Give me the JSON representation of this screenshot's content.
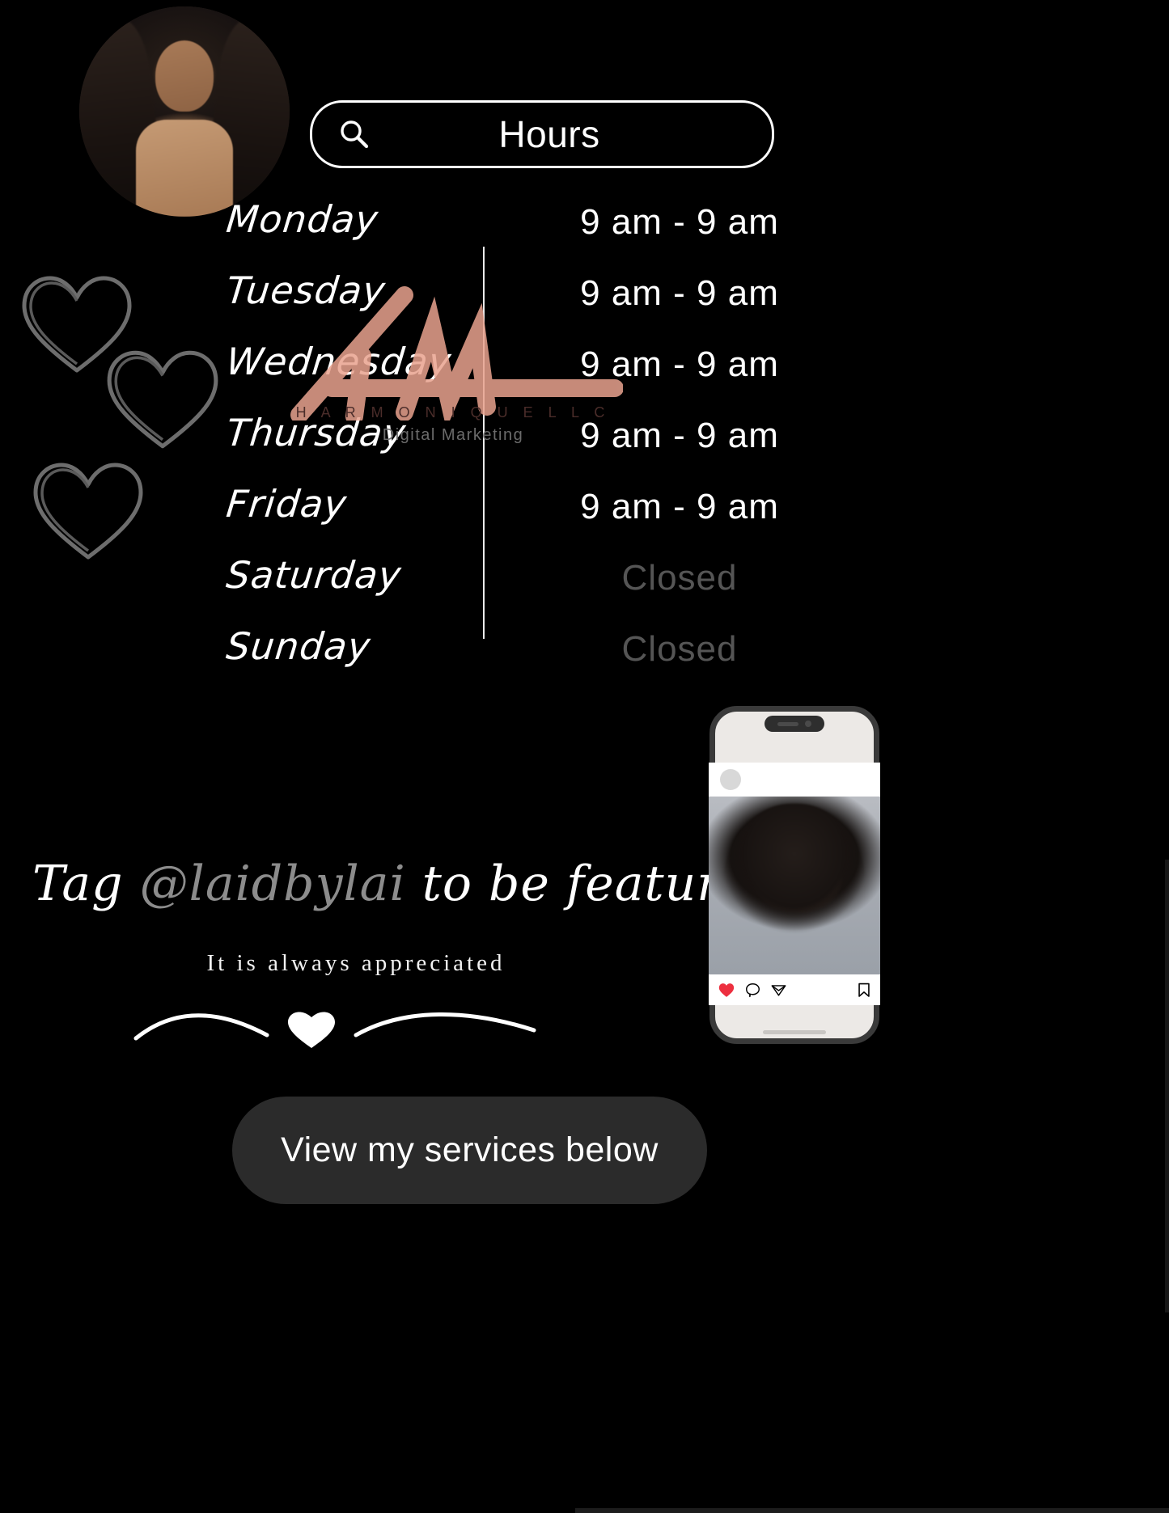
{
  "page": {
    "background_color": "#000000",
    "text_color": "#ffffff"
  },
  "profile": {
    "avatar_alt": "profile-photo-curly-hair"
  },
  "search": {
    "icon": "search-icon",
    "query": "Hours"
  },
  "hours": {
    "divider": true,
    "closed_label": "Closed",
    "closed_color": "#555555",
    "rows": [
      {
        "day": "Monday",
        "time": "9 am - 9 am",
        "closed": false
      },
      {
        "day": "Tuesday",
        "time": "9 am - 9 am",
        "closed": false
      },
      {
        "day": "Wednesday",
        "time": "9 am - 9 am",
        "closed": false
      },
      {
        "day": "Thursday",
        "time": "9 am - 9 am",
        "closed": false
      },
      {
        "day": "Friday",
        "time": "9 am - 9 am",
        "closed": false
      },
      {
        "day": "Saturday",
        "time": "Closed",
        "closed": true
      },
      {
        "day": "Sunday",
        "time": "Closed",
        "closed": true
      }
    ]
  },
  "watermark": {
    "monogram": "HM",
    "company": "H A R M O N I Q U E   L L C",
    "tagline": "Digital Marketing",
    "color": "#e9a38f"
  },
  "decor": {
    "hearts_icon": "heart-outline-icon",
    "heart_count": 3,
    "swirl_icon": "swirl-divider-icon",
    "swirl_heart_icon": "heart-solid-icon"
  },
  "tag_section": {
    "prefix": "Tag ",
    "handle": "@laidbylai",
    "suffix": " to be featured",
    "handle_color": "#8c8c8c",
    "subtitle": "It is always appreciated"
  },
  "phone_mockup": {
    "device": "smartphone-mockup",
    "post": {
      "avatar": "post-avatar",
      "image_alt": "featured-client-photo",
      "actions": [
        {
          "icon": "heart-icon",
          "name": "like-button",
          "active": true,
          "color": "#ed2f3f"
        },
        {
          "icon": "comment-icon",
          "name": "comment-button",
          "active": false,
          "color": "#000000"
        },
        {
          "icon": "share-icon",
          "name": "share-button",
          "active": false,
          "color": "#000000"
        },
        {
          "icon": "bookmark-icon",
          "name": "save-button",
          "active": false,
          "color": "#000000"
        }
      ]
    }
  },
  "cta": {
    "label": "View my services below",
    "background": "#2b2b2b"
  }
}
